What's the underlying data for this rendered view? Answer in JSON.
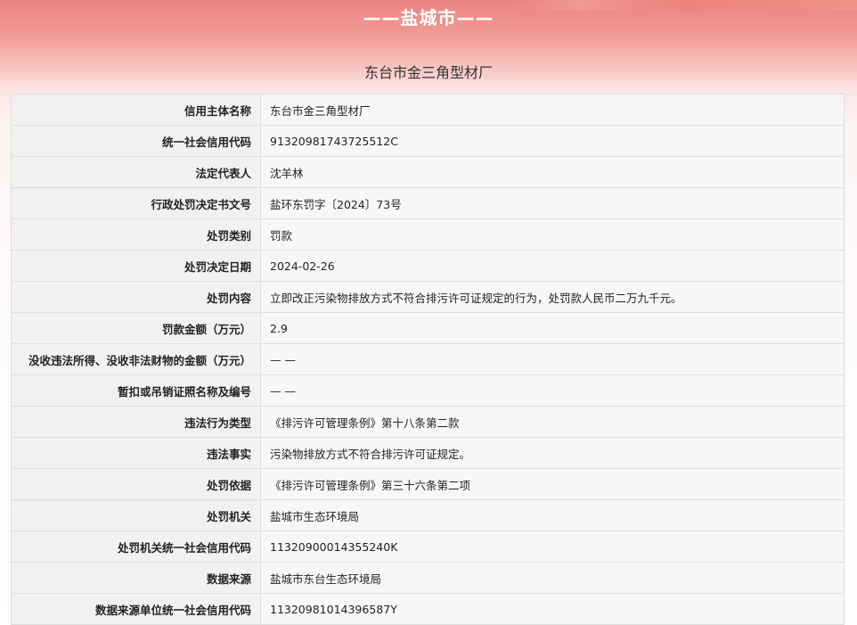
{
  "banner": {
    "city_title": "——盐城市——"
  },
  "company": {
    "name": "东台市金三角型材厂"
  },
  "rows": [
    {
      "label": "信用主体名称",
      "value": "东台市金三角型材厂"
    },
    {
      "label": "统一社会信用代码",
      "value": "91320981743725512C"
    },
    {
      "label": "法定代表人",
      "value": "沈羊林"
    },
    {
      "label": "行政处罚决定书文号",
      "value": "盐环东罚字〔2024〕73号"
    },
    {
      "label": "处罚类别",
      "value": "罚款"
    },
    {
      "label": "处罚决定日期",
      "value": "2024-02-26"
    },
    {
      "label": "处罚内容",
      "value": "立即改正污染物排放方式不符合排污许可证规定的行为，处罚款人民币二万九千元。"
    },
    {
      "label": "罚款金额（万元）",
      "value": "2.9"
    },
    {
      "label": "没收违法所得、没收非法财物的金额（万元）",
      "value": "— —"
    },
    {
      "label": "暂扣或吊销证照名称及编号",
      "value": "— —"
    },
    {
      "label": "违法行为类型",
      "value": "《排污许可管理条例》第十八条第二款"
    },
    {
      "label": "违法事实",
      "value": "污染物排放方式不符合排污许可证规定。"
    },
    {
      "label": "处罚依据",
      "value": "《排污许可管理条例》第三十六条第二项"
    },
    {
      "label": "处罚机关",
      "value": "盐城市生态环境局"
    },
    {
      "label": "处罚机关统一社会信用代码",
      "value": "11320900014355240K"
    },
    {
      "label": "数据来源",
      "value": "盐城市东台生态环境局"
    },
    {
      "label": "数据来源单位统一社会信用代码",
      "value": "11320981014396587Y"
    }
  ]
}
